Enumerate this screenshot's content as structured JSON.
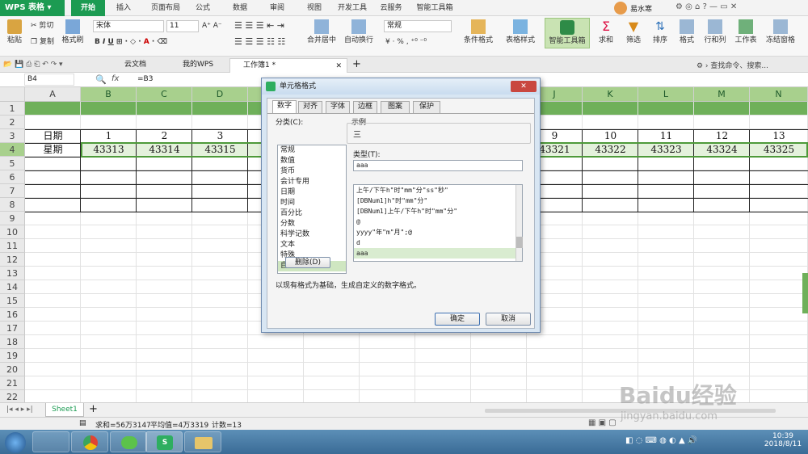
{
  "app": {
    "name": "WPS 表格"
  },
  "menu_tabs": [
    "开始",
    "插入",
    "页面布局",
    "公式",
    "数据",
    "审阅",
    "视图",
    "开发工具",
    "云服务",
    "智能工具箱"
  ],
  "user": {
    "name": "易水寒"
  },
  "ribbon": {
    "paste": "粘贴",
    "cut": "剪切",
    "copy": "复制",
    "format_painter": "格式刷",
    "font_name": "宋体",
    "font_size": "11",
    "merge_center": "合并居中",
    "wrap_text": "自动换行",
    "number_format": "常规",
    "conditional_format": "条件格式",
    "table_style": "表格样式",
    "smart_toolbox": "智能工具箱",
    "sum": "求和",
    "filter": "筛选",
    "sort": "排序",
    "format": "格式",
    "row_col": "行和列",
    "worksheet": "工作表",
    "freeze": "冻结窗格",
    "search_placeholder": "查找命令、搜索..."
  },
  "doc_tabs": [
    {
      "label": "云文档"
    },
    {
      "label": "我的WPS"
    },
    {
      "label": "工作簿1 *"
    }
  ],
  "formula_bar": {
    "cell_ref": "B4",
    "fx": "fx",
    "formula": "=B3"
  },
  "columns": [
    "A",
    "B",
    "C",
    "D",
    "E",
    "F",
    "G",
    "H",
    "I",
    "J",
    "K",
    "L",
    "M",
    "N"
  ],
  "rows": [
    "1",
    "2",
    "3",
    "4",
    "5",
    "6",
    "7",
    "8",
    "9",
    "10",
    "11",
    "12",
    "13",
    "14",
    "15",
    "16",
    "17",
    "18",
    "19",
    "20",
    "21",
    "22"
  ],
  "sheet": {
    "row3": {
      "label": "日期",
      "values": [
        "1",
        "2",
        "3",
        "9",
        "10",
        "11",
        "12",
        "13"
      ]
    },
    "row4": {
      "label": "星期",
      "values": [
        "43313",
        "43314",
        "43315",
        "43321",
        "43322",
        "43323",
        "43324",
        "43325"
      ]
    }
  },
  "sheet_tabs": {
    "active": "Sheet1",
    "add": "+"
  },
  "status": {
    "sum": "求和=56万3147",
    "avg": "平均值=4万3319",
    "count": "计数=13"
  },
  "taskbar": {
    "time": "10:39",
    "date": "2018/8/11"
  },
  "watermark": {
    "text": "Baidu经验",
    "url": "jingyan.baidu.com"
  },
  "dialog": {
    "title": "单元格格式",
    "tabs": [
      "数字",
      "对齐",
      "字体",
      "边框",
      "图案",
      "保护"
    ],
    "category_label": "分类(C):",
    "categories": [
      "常规",
      "数值",
      "货币",
      "会计专用",
      "日期",
      "时间",
      "百分比",
      "分数",
      "科学记数",
      "文本",
      "特殊",
      "自定义"
    ],
    "selected_category": "自定义",
    "sample_label": "示例",
    "sample_value": "三",
    "type_label": "类型(T):",
    "type_value": "aaa",
    "type_items": [
      "上午/下午h\"时\"mm\"分\"ss\"秒\"",
      "[DBNum1]h\"时\"mm\"分\"",
      "[DBNum1]上午/下午h\"时\"mm\"分\"",
      "@",
      "yyyy\"年\"m\"月\";@",
      "d",
      "aaa"
    ],
    "delete_button": "删除(D)",
    "hint": "以现有格式为基础，生成自定义的数字格式。",
    "ok": "确定",
    "cancel": "取消"
  }
}
